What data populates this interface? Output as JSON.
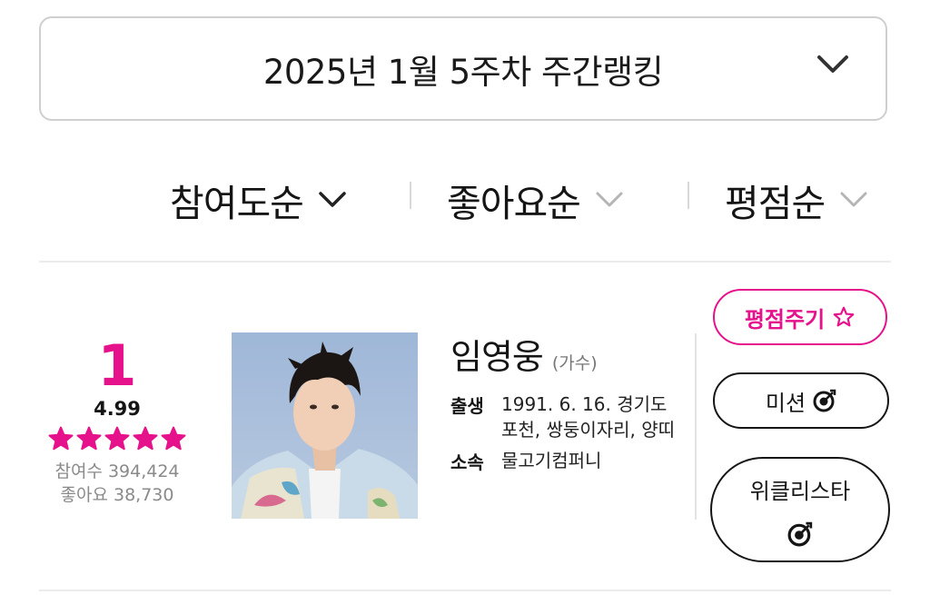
{
  "week_selector": {
    "label": "2025년 1월 5주차 주간랭킹",
    "icon": "chevron-down-icon"
  },
  "sort_tabs": [
    {
      "label": "참여도순",
      "active": true
    },
    {
      "label": "좋아요순",
      "active": false
    },
    {
      "label": "평점순",
      "active": false
    }
  ],
  "ranking": {
    "rank": "1",
    "score": "4.99",
    "stars": 5,
    "participants_label": "참여수 394,424",
    "likes_label": "좋아요 38,730",
    "name": "임영웅",
    "role": "(가수)",
    "birth_key": "출생",
    "birth_value": "1991. 6. 16. 경기도 포천, 쌍둥이자리, 양띠",
    "agency_key": "소속",
    "agency_value": "물고기컴퍼니"
  },
  "actions": {
    "rate_label": "평점주기",
    "mission_label": "미션",
    "weekly_star_label": "위클리스타"
  },
  "colors": {
    "accent": "#e5128b",
    "text": "#151515",
    "muted": "#8a8a8a",
    "border": "#cfcfcf"
  }
}
